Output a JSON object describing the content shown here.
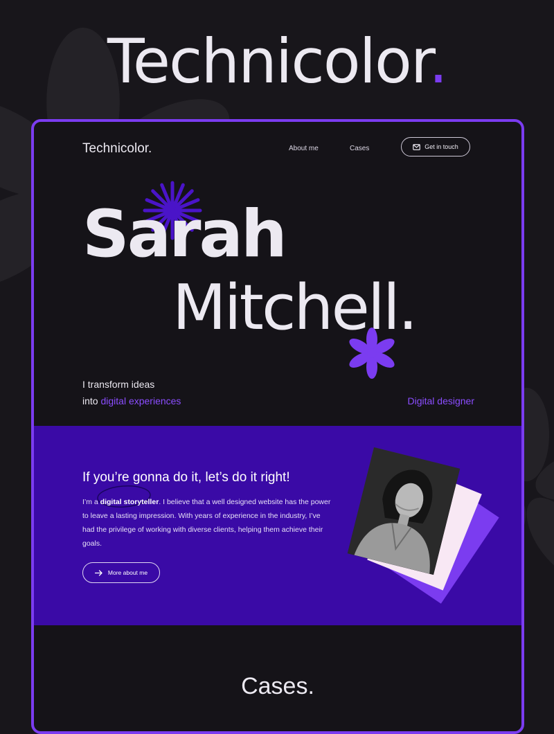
{
  "hero": {
    "title": "Technicolor",
    "dot": "."
  },
  "nav": {
    "logo": "Technicolor.",
    "links": [
      "About me",
      "Cases"
    ],
    "cta_label": "Get in touch",
    "cta_icon": "mail-icon"
  },
  "intro": {
    "first_name": "Sarah",
    "last_name": "Mitchell",
    "last_dot": ".",
    "tagline_line1": "I transform ideas",
    "tagline_line2_prefix": "into ",
    "tagline_line2_accent": "digital experiences",
    "role": "Digital designer"
  },
  "about": {
    "heading": "If you’re gonna do it, let’s do it right!",
    "text_prefix": "I’m a ",
    "text_bold": "digital storyteller",
    "text_rest": ". I believe that a well designed website has the power to leave a lasting impression. With years of experience in the industry, I’ve had the privilege of working with diverse clients, helping them achieve their goals.",
    "button_label": "More about me",
    "button_icon": "arrow-right-icon"
  },
  "cases": {
    "title": "Cases."
  },
  "colors": {
    "accent": "#7b3cf0",
    "accent_text": "#8b4dff",
    "about_bg": "#3a0aa6",
    "page_bg": "#18161b",
    "card_pink": "#f8e8f4"
  }
}
